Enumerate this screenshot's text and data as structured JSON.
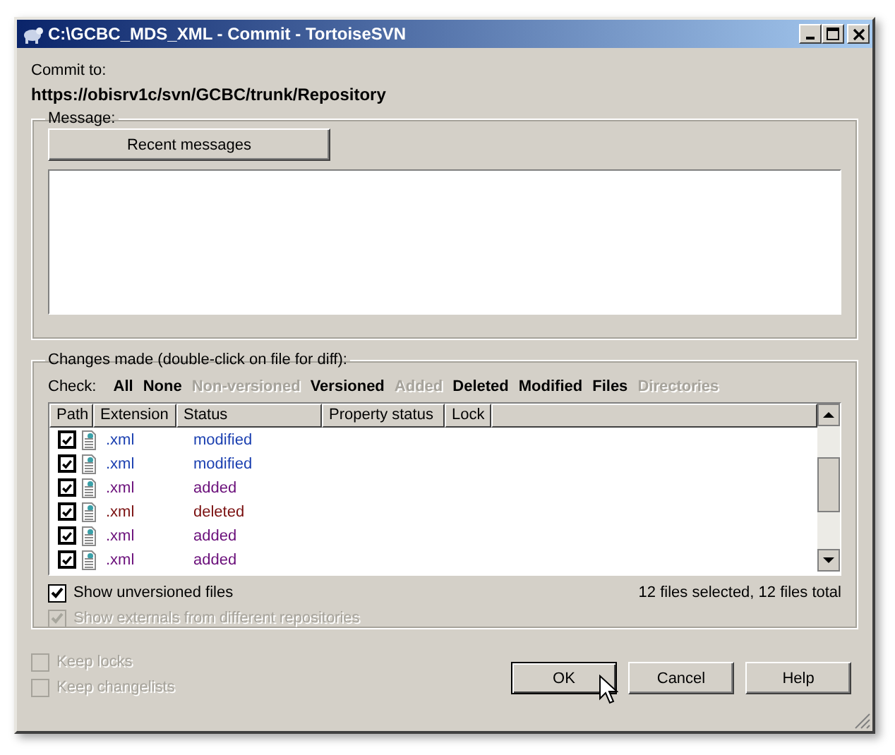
{
  "window": {
    "title": "C:\\GCBC_MDS_XML - Commit - TortoiseSVN"
  },
  "commit_to": {
    "label": "Commit to:",
    "url": "https://obisrv1c/svn/GCBC/trunk/Repository"
  },
  "message": {
    "group_label": "Message:",
    "recent_button": "Recent messages"
  },
  "changes": {
    "group_label": "Changes made (double-click on file for diff):",
    "check_label": "Check:",
    "filters": [
      {
        "label": "All",
        "disabled": false
      },
      {
        "label": "None",
        "disabled": false
      },
      {
        "label": "Non-versioned",
        "disabled": true
      },
      {
        "label": "Versioned",
        "disabled": false
      },
      {
        "label": "Added",
        "disabled": true
      },
      {
        "label": "Deleted",
        "disabled": false
      },
      {
        "label": "Modified",
        "disabled": false
      },
      {
        "label": "Files",
        "disabled": false
      },
      {
        "label": "Directories",
        "disabled": true
      }
    ],
    "columns": [
      "Path",
      "Extension",
      "Status",
      "Property status",
      "Lock"
    ],
    "rows": [
      {
        "checked": true,
        "extension": ".xml",
        "status": "modified",
        "color": "#1a3fb0"
      },
      {
        "checked": true,
        "extension": ".xml",
        "status": "modified",
        "color": "#1a3fb0"
      },
      {
        "checked": true,
        "extension": ".xml",
        "status": "added",
        "color": "#6a0f7a"
      },
      {
        "checked": true,
        "extension": ".xml",
        "status": "deleted",
        "color": "#7a1010"
      },
      {
        "checked": true,
        "extension": ".xml",
        "status": "added",
        "color": "#6a0f7a"
      },
      {
        "checked": true,
        "extension": ".xml",
        "status": "added",
        "color": "#6a0f7a"
      }
    ],
    "options": [
      {
        "label": "Show unversioned files",
        "checked": true,
        "disabled": false
      },
      {
        "label": "Show externals from different repositories",
        "checked": true,
        "disabled": true
      }
    ],
    "summary": "12 files selected, 12 files total"
  },
  "bottom_options": [
    {
      "label": "Keep locks",
      "checked": false,
      "disabled": true
    },
    {
      "label": "Keep changelists",
      "checked": false,
      "disabled": true
    }
  ],
  "buttons": [
    {
      "label": "OK",
      "default": true
    },
    {
      "label": "Cancel",
      "default": false
    },
    {
      "label": "Help",
      "default": false
    }
  ]
}
